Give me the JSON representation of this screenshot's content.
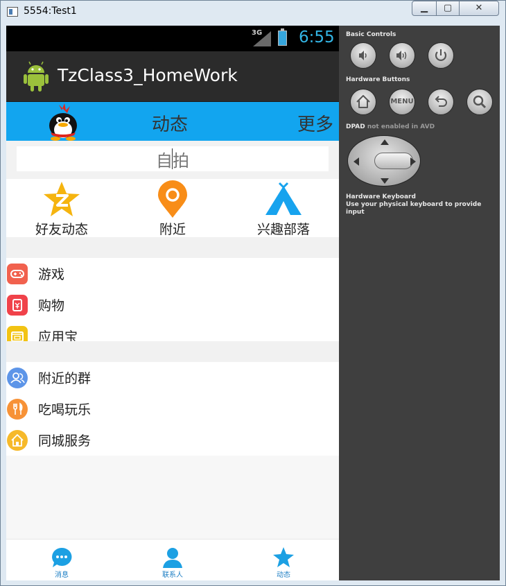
{
  "window": {
    "title": "5554:Test1",
    "min_label": "▁",
    "max_label": "▢",
    "close_label": "✕"
  },
  "status_bar": {
    "network": "3G",
    "time": "6:55"
  },
  "action_bar": {
    "title": "TzClass3_HomeWork"
  },
  "top_tabs": {
    "tab_dynamic": "动态",
    "tab_more": "更多"
  },
  "search": {
    "value": "自拍"
  },
  "categories": [
    {
      "label": "好友动态",
      "icon": "star-z-icon",
      "color": "#f5b40f"
    },
    {
      "label": "附近",
      "icon": "location-pin-icon",
      "color": "#f88d18"
    },
    {
      "label": "兴趣部落",
      "icon": "tent-icon",
      "color": "#17a3ee"
    }
  ],
  "list_group_1": [
    {
      "label": "游戏",
      "icon": "gamepad-icon",
      "color": "#f1614e"
    },
    {
      "label": "购物",
      "icon": "shopping-bag-icon",
      "color": "#f0424a"
    },
    {
      "label": "应用宝",
      "icon": "app-store-icon",
      "color": "#f2c313"
    }
  ],
  "list_group_2": [
    {
      "label": "附近的群",
      "icon": "group-icon",
      "color": "#5d95e8"
    },
    {
      "label": "吃喝玩乐",
      "icon": "fork-knife-icon",
      "color": "#f79237"
    },
    {
      "label": "同城服务",
      "icon": "home-icon",
      "color": "#f6b92a"
    }
  ],
  "bottom_tabs": [
    {
      "label": "消息",
      "icon": "chat-bubble-icon"
    },
    {
      "label": "联系人",
      "icon": "contact-person-icon"
    },
    {
      "label": "动态",
      "icon": "star-icon"
    }
  ],
  "emulator": {
    "basic_controls": "Basic Controls",
    "hardware_buttons": "Hardware Buttons",
    "menu_label": "MENU",
    "dpad_label": "DPAD",
    "dpad_note": "not enabled in AVD",
    "keyboard_title": "Hardware Keyboard",
    "keyboard_note": "Use your physical keyboard to provide input"
  },
  "colors": {
    "accent": "#12a5ef",
    "status_time": "#33b5e5"
  }
}
